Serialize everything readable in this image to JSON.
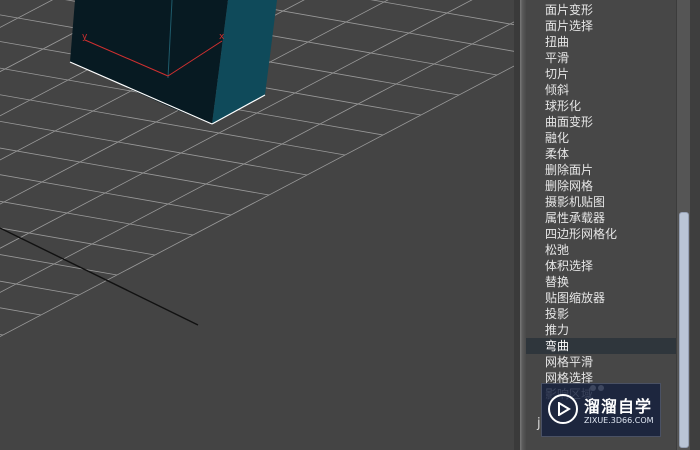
{
  "viewport": {
    "axes": {
      "y_label": "y",
      "x_label": "x"
    },
    "colors": {
      "grid": "#9a9a9a",
      "background": "#444444",
      "box_front": "#071a22",
      "box_side": "#0f4a5a",
      "axis": "#d03030"
    }
  },
  "modifier_list": {
    "items": [
      "面片变形",
      "面片选择",
      "扭曲",
      "平滑",
      "切片",
      "倾斜",
      "球形化",
      "曲面变形",
      "融化",
      "柔体",
      "删除面片",
      "删除网格",
      "摄影机贴图",
      "属性承载器",
      "四边形网格化",
      "松弛",
      "体积选择",
      "替换",
      "贴图缩放器",
      "投影",
      "推力",
      "弯曲",
      "网格平滑",
      "网格选择",
      "影响区域"
    ],
    "selected_index": 21
  },
  "scrollbar": {
    "position": 0.62
  },
  "watermark": {
    "title": "溜溜自学",
    "url": "ZIXUE.3D66.COM"
  }
}
